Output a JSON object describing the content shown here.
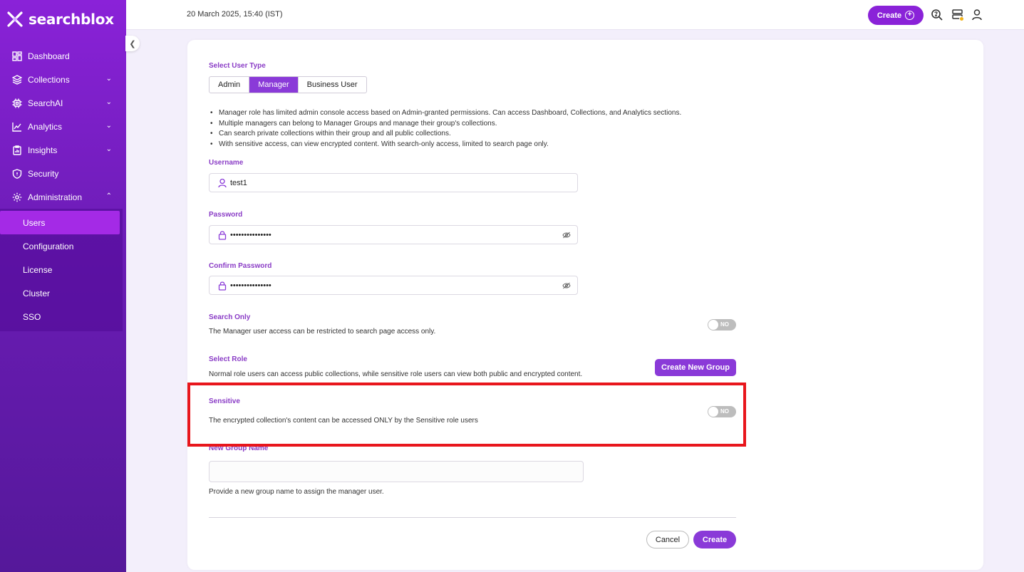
{
  "app": {
    "logo_text": "searchblox"
  },
  "topbar": {
    "datetime": "20 March 2025, 15:40 (IST)",
    "create_label": "Create"
  },
  "sidebar": {
    "items": [
      {
        "label": "Dashboard",
        "icon": "dashboard-icon"
      },
      {
        "label": "Collections",
        "icon": "layers-icon",
        "has_chevron": true
      },
      {
        "label": "SearchAI",
        "icon": "chip-icon",
        "has_chevron": true
      },
      {
        "label": "Analytics",
        "icon": "chart-icon",
        "has_chevron": true
      },
      {
        "label": "Insights",
        "icon": "clipboard-icon",
        "has_chevron": true
      },
      {
        "label": "Security",
        "icon": "shield-icon"
      },
      {
        "label": "Administration",
        "icon": "gear-icon",
        "expanded": true
      }
    ],
    "admin_sub": [
      "Users",
      "Configuration",
      "License",
      "Cluster",
      "SSO"
    ],
    "active_sub": "Users"
  },
  "form": {
    "user_type_label": "Select User Type",
    "user_types": [
      "Admin",
      "Manager",
      "Business User"
    ],
    "selected_type": "Manager",
    "bullets": [
      "Manager role has limited admin console access based on Admin-granted permissions. Can access Dashboard, Collections, and Analytics sections.",
      "Multiple managers can belong to Manager Groups and manage their group's collections.",
      "Can search private collections within their group and all public collections.",
      "With sensitive access, can view encrypted content. With search-only access, limited to search page only."
    ],
    "username_label": "Username",
    "username_value": "test1",
    "password_label": "Password",
    "password_value": "•••••••••••••••",
    "confirm_label": "Confirm Password",
    "confirm_value": "•••••••••••••••",
    "search_only_label": "Search Only",
    "search_only_desc": "The Manager user access can be restricted to search page access only.",
    "search_only_toggle": "NO",
    "select_role_label": "Select Role",
    "select_role_desc": "Normal role users can access public collections, while sensitive role users can view both public and encrypted content.",
    "create_group_label": "Create New Group",
    "sensitive_label": "Sensitive",
    "sensitive_desc": "The encrypted collection's content can be accessed ONLY by the Sensitive role users",
    "sensitive_toggle": "NO",
    "new_group_label": "New Group Name",
    "new_group_value": "",
    "new_group_help": "Provide a new group name to assign the manager user.",
    "cancel_label": "Cancel",
    "create_label": "Create"
  },
  "colors": {
    "accent": "#8a3ad8",
    "highlight": "#e8161c"
  }
}
